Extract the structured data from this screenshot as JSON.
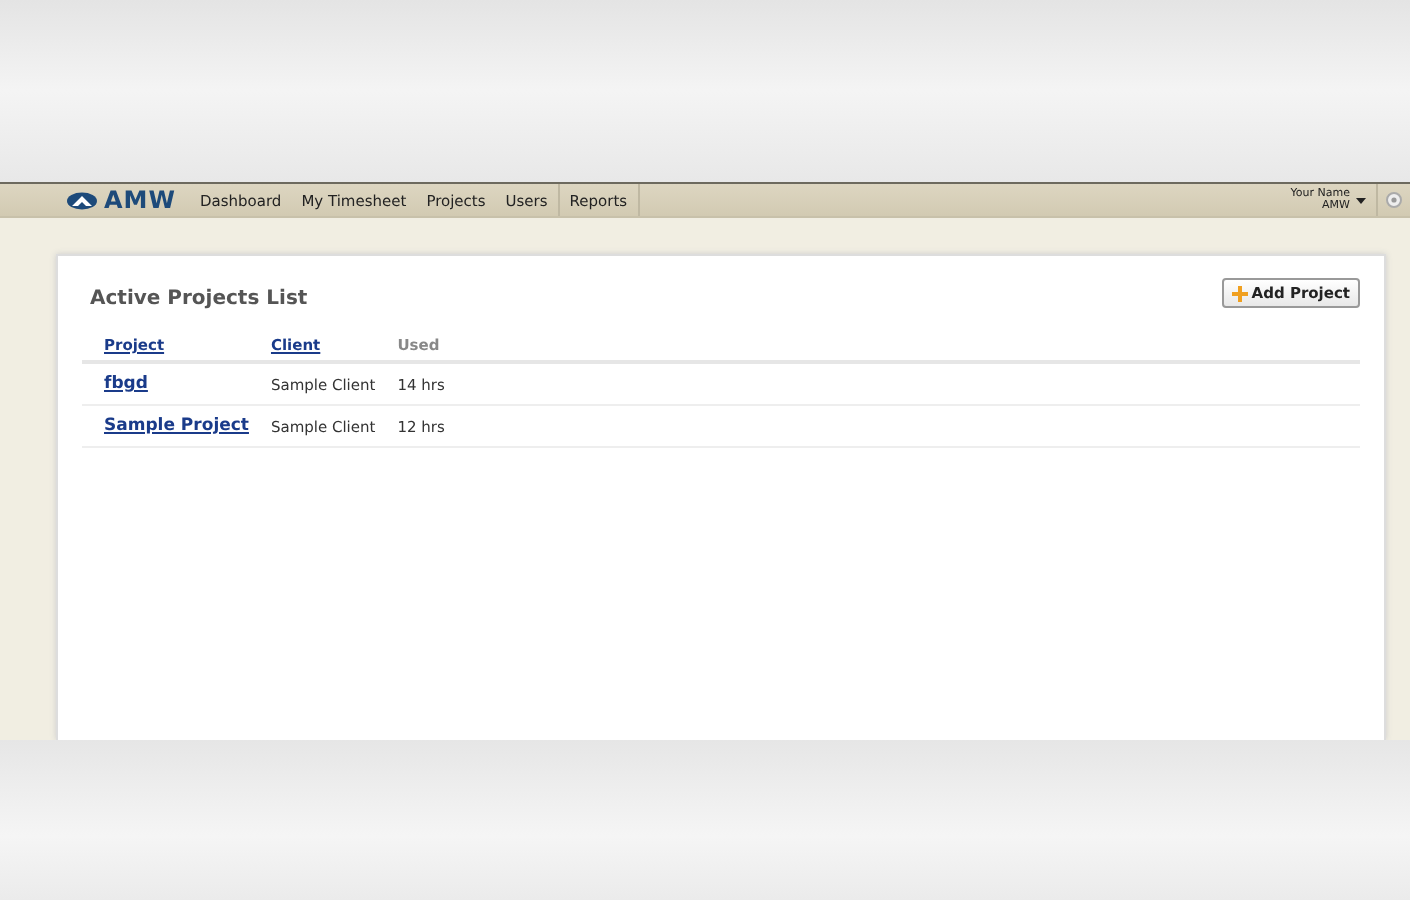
{
  "brand": {
    "name": "AMW"
  },
  "nav": [
    {
      "label": "Dashboard",
      "selected": false
    },
    {
      "label": "My Timesheet",
      "selected": false
    },
    {
      "label": "Projects",
      "selected": false
    },
    {
      "label": "Users",
      "selected": false
    },
    {
      "label": "Reports",
      "selected": true
    }
  ],
  "user": {
    "name": "Your Name",
    "org": "AMW"
  },
  "panel": {
    "title": "Active Projects List",
    "add_button": "Add Project"
  },
  "table": {
    "columns": [
      {
        "label": "Project",
        "link": true
      },
      {
        "label": "Client",
        "link": true
      },
      {
        "label": "Used",
        "link": false
      }
    ],
    "rows": [
      [
        "fbgd",
        "Sample Client",
        "14 hrs"
      ],
      [
        "Sample Project",
        "Sample Client",
        "12 hrs"
      ]
    ]
  }
}
